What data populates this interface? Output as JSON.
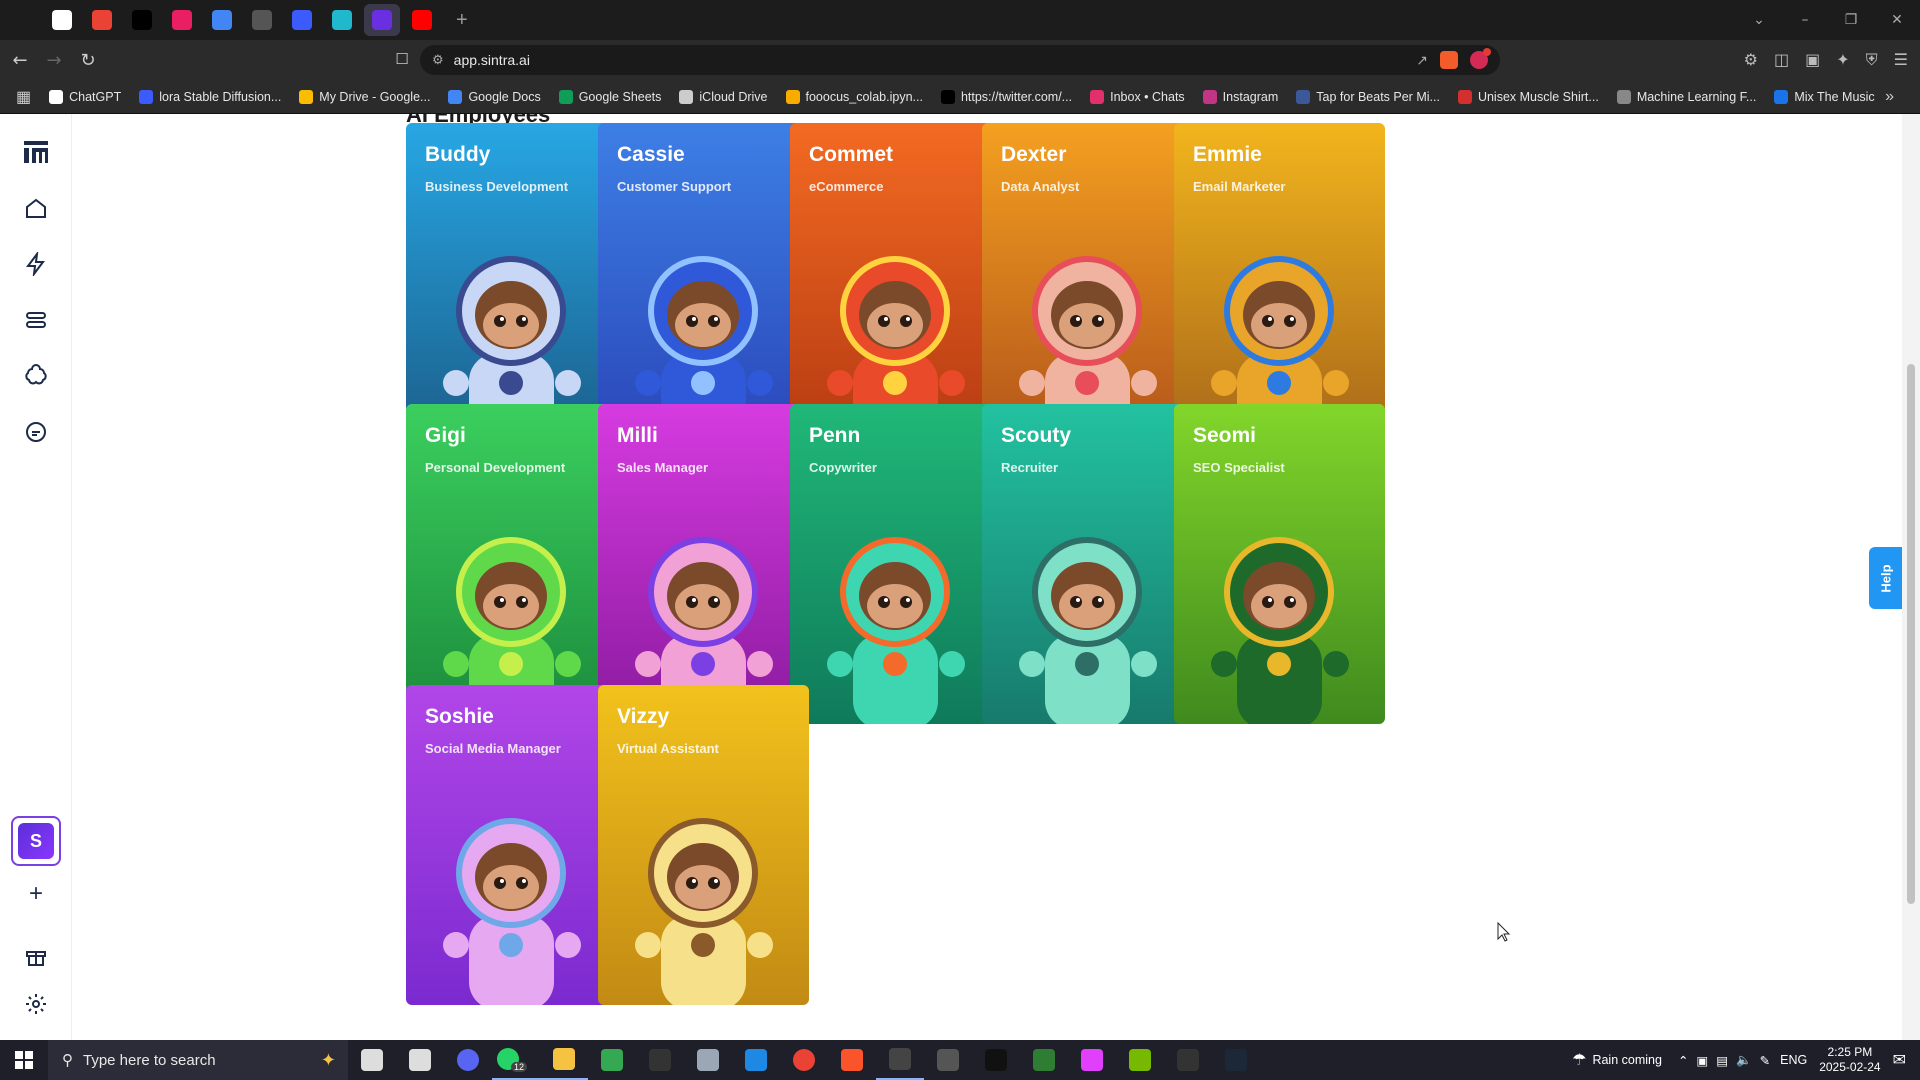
{
  "browser": {
    "tabs": [
      {
        "icon": "grid-app-icon",
        "color": "#1c1c1c"
      },
      {
        "icon": "chatgpt-icon",
        "color": "#ffffff"
      },
      {
        "icon": "gmail-icon",
        "color": "#ea4335"
      },
      {
        "icon": "x-twitter-icon",
        "color": "#000000"
      },
      {
        "icon": "pink-app-icon",
        "color": "#e91e63"
      },
      {
        "icon": "docs-icon",
        "color": "#4285f4"
      },
      {
        "icon": "openai-icon",
        "color": "#555555"
      },
      {
        "icon": "shield-check-icon",
        "color": "#3b5bfd"
      },
      {
        "icon": "perplexity-icon",
        "color": "#20b8cd"
      },
      {
        "icon": "sintra-icon",
        "color": "#6b2fe2"
      },
      {
        "icon": "youtube-icon",
        "color": "#ff0000"
      }
    ],
    "url": "app.sintra.ai",
    "bookmarks": [
      {
        "label": "ChatGPT",
        "color": "#ffffff"
      },
      {
        "label": "lora Stable Diffusion...",
        "color": "#3b5bfd"
      },
      {
        "label": "My Drive - Google...",
        "color": "#fbbc04"
      },
      {
        "label": "Google Docs",
        "color": "#4285f4"
      },
      {
        "label": "Google Sheets",
        "color": "#0f9d58"
      },
      {
        "label": "iCloud Drive",
        "color": "#cccccc"
      },
      {
        "label": "fooocus_colab.ipyn...",
        "color": "#f9ab00"
      },
      {
        "label": "https://twitter.com/...",
        "color": "#000000"
      },
      {
        "label": "Inbox • Chats",
        "color": "#e1306c"
      },
      {
        "label": "Instagram",
        "color": "#c13584"
      },
      {
        "label": "Tap for Beats Per Mi...",
        "color": "#3b5998"
      },
      {
        "label": "Unisex Muscle Shirt...",
        "color": "#d32f2f"
      },
      {
        "label": "Machine Learning F...",
        "color": "#888888"
      },
      {
        "label": "Mix The Music",
        "color": "#1a73e8"
      }
    ]
  },
  "sidebar": {
    "items": [
      {
        "icon": "sintra-logo-icon"
      },
      {
        "icon": "home-icon"
      },
      {
        "icon": "lightning-icon"
      },
      {
        "icon": "toggles-icon"
      },
      {
        "icon": "brain-icon"
      },
      {
        "icon": "chat-bubble-icon"
      }
    ],
    "workspace_letter": "S",
    "bottom": [
      {
        "icon": "plus-icon"
      },
      {
        "icon": "gift-icon"
      },
      {
        "icon": "gear-icon"
      }
    ]
  },
  "main": {
    "section_title": "AI Employees",
    "help_label": "Help",
    "employees": [
      {
        "name": "Buddy",
        "role": "Business Development",
        "color_top": "#27a7e4",
        "color_bottom": "#1b5e8a",
        "suit": "#c7d7f5",
        "accent": "#3a4a90"
      },
      {
        "name": "Cassie",
        "role": "Customer Support",
        "color_top": "#3d7fe6",
        "color_bottom": "#2a46b8",
        "suit": "#2f59d9",
        "accent": "#91c2ff"
      },
      {
        "name": "Commet",
        "role": "eCommerce",
        "color_top": "#f36a22",
        "color_bottom": "#b53a12",
        "suit": "#e84a2a",
        "accent": "#ffd23f"
      },
      {
        "name": "Dexter",
        "role": "Data Analyst",
        "color_top": "#f4a020",
        "color_bottom": "#b2541a",
        "suit": "#f0b3a0",
        "accent": "#e84e5a"
      },
      {
        "name": "Emmie",
        "role": "Email Marketer",
        "color_top": "#f2b51c",
        "color_bottom": "#a8671a",
        "suit": "#e8a52a",
        "accent": "#2d7be0"
      },
      {
        "name": "Gigi",
        "role": "Personal Development",
        "color_top": "#3bcf5e",
        "color_bottom": "#1b8a3c",
        "suit": "#5fd94a",
        "accent": "#c5f04c"
      },
      {
        "name": "Milli",
        "role": "Sales Manager",
        "color_top": "#d63be0",
        "color_bottom": "#8a1a9e",
        "suit": "#f2a1d6",
        "accent": "#7b3fe4"
      },
      {
        "name": "Penn",
        "role": "Copywriter",
        "color_top": "#20b878",
        "color_bottom": "#0f7a5a",
        "suit": "#3dd6b0",
        "accent": "#f46a2a"
      },
      {
        "name": "Scouty",
        "role": "Recruiter",
        "color_top": "#22c2a0",
        "color_bottom": "#177a6c",
        "suit": "#7fe0c8",
        "accent": "#2d6e66"
      },
      {
        "name": "Seomi",
        "role": "SEO Specialist",
        "color_top": "#82d62a",
        "color_bottom": "#3f8a1e",
        "suit": "#1e6a2a",
        "accent": "#e8b82a"
      },
      {
        "name": "Soshie",
        "role": "Social Media Manager",
        "color_top": "#b246e8",
        "color_bottom": "#7a2ad0",
        "suit": "#e6a8f0",
        "accent": "#6fa8e8"
      },
      {
        "name": "Vizzy",
        "role": "Virtual Assistant",
        "color_top": "#f2c21c",
        "color_bottom": "#c28a14",
        "suit": "#f6e08a",
        "accent": "#8a5a2a"
      }
    ]
  },
  "taskbar": {
    "search_placeholder": "Type here to search",
    "weather": "Rain coming",
    "lang": "ENG",
    "time": "2:25 PM",
    "date": "2025-02-24",
    "whatsapp_badge": "12",
    "apps": [
      {
        "icon": "task-view-icon",
        "color": "#dddddd"
      },
      {
        "icon": "settings-icon",
        "color": "#dddddd"
      },
      {
        "icon": "discord-icon",
        "color": "#5865f2"
      },
      {
        "icon": "whatsapp-icon",
        "color": "#25d366"
      },
      {
        "icon": "file-explorer-icon",
        "color": "#f5c242"
      },
      {
        "icon": "google-drive-icon",
        "color": "#34a853"
      },
      {
        "icon": "terminal-icon",
        "color": "#333333"
      },
      {
        "icon": "app-icon",
        "color": "#9aa7b5"
      },
      {
        "icon": "snipping-icon",
        "color": "#1e88e5"
      },
      {
        "icon": "chrome-icon",
        "color": "#ea4335"
      },
      {
        "icon": "brave-icon",
        "color": "#fb542b"
      },
      {
        "icon": "obs-icon",
        "color": "#444444"
      },
      {
        "icon": "davinci-icon",
        "color": "#555555"
      },
      {
        "icon": "capcut-icon",
        "color": "#111111"
      },
      {
        "icon": "live-icon",
        "color": "#2e7d32"
      },
      {
        "icon": "color-app-icon",
        "color": "#e040fb"
      },
      {
        "icon": "nvidia-icon",
        "color": "#76b900"
      },
      {
        "icon": "epic-games-icon",
        "color": "#333333"
      },
      {
        "icon": "steam-icon",
        "color": "#1b2838"
      }
    ]
  }
}
